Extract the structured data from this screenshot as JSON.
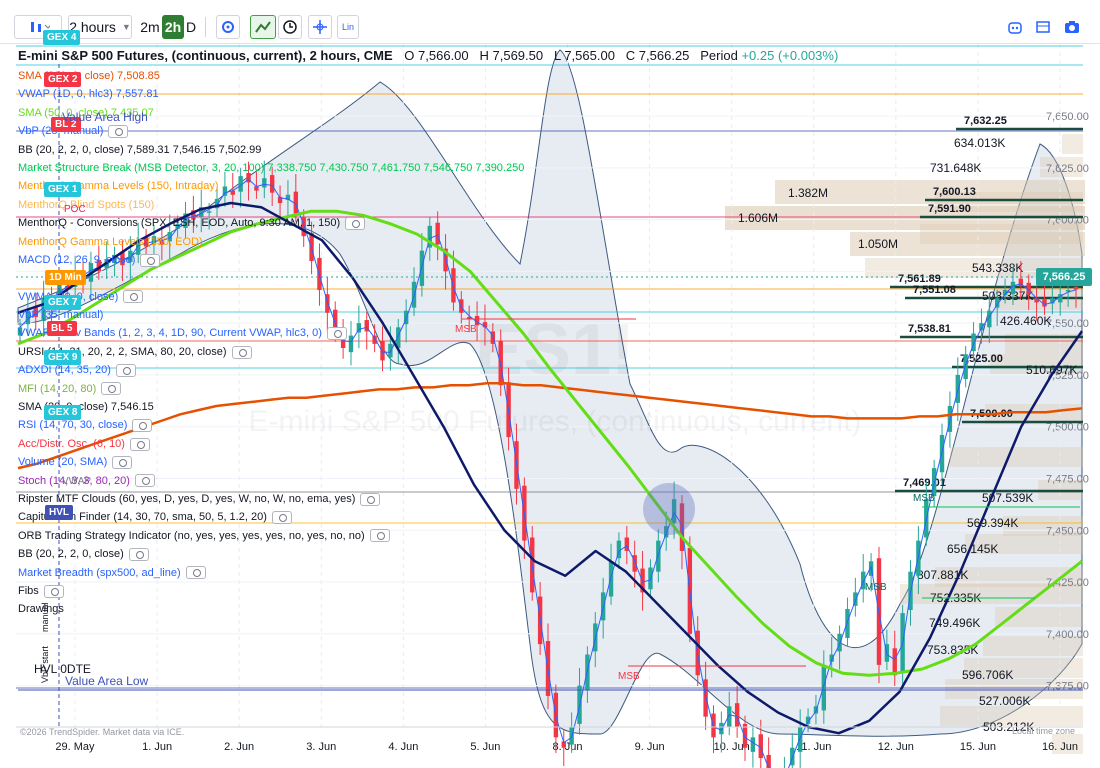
{
  "toolbar": {
    "interval": "2 hours",
    "intervals": [
      "2m",
      "2h",
      "D"
    ],
    "scale_mode": "Lin"
  },
  "title": {
    "symbol": "E-mini S&P 500 Futures, (continuous, current), 2 hours, CME",
    "o_label": "O",
    "o": "7,566.00",
    "h_label": "H",
    "h": "7,569.50",
    "l_label": "L",
    "l": "7,565.00",
    "c_label": "C",
    "c": "7,566.25",
    "period_label": "Period",
    "period_change": "+0.25 (+0.003%)"
  },
  "watermark": {
    "symbol": "ES1!",
    "name": "E-mini S&P 500 Futures, (continuous, current)"
  },
  "indicators": [
    {
      "text": "SMA (200, 0, close)  7,508.85",
      "color": "#e65100",
      "eye": false
    },
    {
      "text": "VWAP (1D, 0, hlc3)  7,557.81",
      "color": "#2962ff",
      "eye": false
    },
    {
      "text": "SMA (50, 0, close)  7,435.07",
      "color": "#64dd17",
      "eye": false
    },
    {
      "text": "VbP (25, manual)",
      "color": "#2962ff",
      "eye": true
    },
    {
      "text": "BB (20, 2, 2, 0, close)  7,589.31  7,546.15  7,502.99",
      "color": "#131722",
      "eye": false
    },
    {
      "text": "Market Structure Break (MSB Detector, 3, 20, 100)  7,338.750  7,430.750  7,461.750  7,546.750  7,390.250",
      "color": "#00c853",
      "eye": false
    },
    {
      "text": "MenthorQ Gamma Levels (150, Intraday)",
      "color": "#ff9800",
      "eye": false
    },
    {
      "text": "MenthorQ Blind Spots (150)",
      "color": "#ffb74d",
      "eye": false
    },
    {
      "text": "MenthorQ - Conversions (SPX, ESH, EOD, Auto, 9:30 AM, 1, 150)",
      "color": "#131722",
      "eye": true
    },
    {
      "text": "MenthorQ Gamma Levels (150, EOD)",
      "color": "#ff9800",
      "eye": false
    },
    {
      "text": "MACD (12, 26, 9, close)",
      "color": "#2962ff",
      "eye": true
    },
    {
      "text": "",
      "color": "#131722",
      "eye": false
    },
    {
      "text": "VWMA (20, 0, close)",
      "color": "#2962ff",
      "eye": true
    },
    {
      "text": "VbP (35, manual)",
      "color": "#2962ff",
      "eye": false
    },
    {
      "text": "VWAP Stdev Bands (1, 2, 3, 4, 1D, 90, Current VWAP, hlc3, 0)",
      "color": "#2962ff",
      "eye": true
    },
    {
      "text": "URSI (14, 21, 20, 2, 2, SMA, 80, 20, close)",
      "color": "#131722",
      "eye": true
    },
    {
      "text": "ADXDI (14, 35, 20)",
      "color": "#2962ff",
      "eye": true
    },
    {
      "text": "MFI (14, 20, 80)",
      "color": "#7cb342",
      "eye": true
    },
    {
      "text": "SMA (20, 0, close)  7,546.15",
      "color": "#131722",
      "eye": false
    },
    {
      "text": "RSI (14, 70, 30, close)",
      "color": "#2962ff",
      "eye": true
    },
    {
      "text": "Acc/Distr. Osc. (6, 10)",
      "color": "#f23645",
      "eye": true
    },
    {
      "text": "Volume (20, SMA)",
      "color": "#2962ff",
      "eye": true
    },
    {
      "text": "Stoch (14, 3, 3, 80, 20)",
      "color": "#9c27b0",
      "eye": true
    },
    {
      "text": "Ripster MTF Clouds (60, yes, D, yes, D, yes, W, no, W, no, ema, yes)",
      "color": "#131722",
      "eye": true
    },
    {
      "text": "Capitulation Finder (14, 30, 70, sma, 50, 5, 1.2, 20)",
      "color": "#131722",
      "eye": true
    },
    {
      "text": "ORB Trading Strategy Indicator (no, yes, yes, yes, yes, no, yes, no, no)",
      "color": "#131722",
      "eye": true
    },
    {
      "text": "BB (20, 2, 2, 0, close)",
      "color": "#131722",
      "eye": true
    },
    {
      "text": "Market Breadth (spx500, ad_line)",
      "color": "#2962ff",
      "eye": true
    },
    {
      "text": "Fibs",
      "color": "#131722",
      "eye": true
    },
    {
      "text": "Drawings",
      "color": "#131722",
      "eye": false
    }
  ],
  "badges": [
    {
      "text": "GEX 4",
      "color": "#26c6da"
    },
    {
      "text": "GEX 2",
      "color": "#f23645"
    },
    {
      "text": "BL 2",
      "color": "#f23645"
    },
    {
      "text": "GEX 1",
      "color": "#26c6da"
    },
    {
      "text": "1D Min",
      "color": "#ff9800"
    },
    {
      "text": "GEX 7",
      "color": "#26c6da"
    },
    {
      "text": "BL 5",
      "color": "#f23645"
    },
    {
      "text": "GEX 9",
      "color": "#26c6da"
    },
    {
      "text": "GEX 8",
      "color": "#26c6da"
    },
    {
      "text": "HVL",
      "color": "#3f51b5"
    }
  ],
  "chart_labels": {
    "value_area_high": "Value Area High",
    "value_area_low": "Value Area Low",
    "poc": "POC",
    "hvl_0dte": "HVL 0DTE",
    "vwap": "VWAP",
    "msb": "MSB",
    "vbp_start": "VbP start",
    "manual": "manual",
    "footer": "©2026 TrendSpider. Market data via ICE.",
    "local_time": "Local time zone"
  },
  "last_price": "7,566.25",
  "levels": [
    "7,632.25",
    "7,600.13",
    "7,591.90",
    "7,561.89",
    "7,551.08",
    "7,538.81",
    "7,525.00",
    "7,500.00",
    "7,469.01"
  ],
  "volume_profile": [
    "634.013K",
    "731.648K",
    "1.382M",
    "1.606M",
    "1.050M",
    "543.338K",
    "503.337K",
    "426.460K",
    "510.697K",
    "507.539K",
    "569.394K",
    "656.145K",
    "807.881K",
    "752.335K",
    "749.496K",
    "753.835K",
    "596.706K",
    "527.006K",
    "503.212K"
  ],
  "colors": {
    "up_candle": "#26a69a",
    "down_candle": "#f23645",
    "sma200": "#e65100",
    "sma50": "#64dd17",
    "sma20_navy": "#0d1a6b",
    "vwap": "#2962ff",
    "bb_fill": "#dfe6ee",
    "vp_bar": "#d9c7ad",
    "level_line": "#1b4d3e"
  },
  "chart_data": {
    "type": "candlestick",
    "title": "E-mini S&P 500 Futures, (continuous, current), 2 hours, CME",
    "x_ticks": [
      "29. May",
      "1. Jun",
      "2. Jun",
      "3. Jun",
      "4. Jun",
      "5. Jun",
      "8. Jun",
      "9. Jun",
      "10. Jun",
      "11. Jun",
      "12. Jun",
      "15. Jun",
      "16. Jun"
    ],
    "y_ticks": [
      7650.0,
      7625.0,
      7600.0,
      7575.0,
      7550.0,
      7525.0,
      7500.0,
      7475.0,
      7450.0,
      7425.0,
      7400.0,
      7375.0
    ],
    "y_range": [
      7355,
      7665
    ],
    "last": {
      "open": 7566.0,
      "high": 7569.5,
      "low": 7565.0,
      "close": 7566.25
    },
    "closes": [
      7548,
      7556,
      7553,
      7562,
      7559,
      7570,
      7566,
      7574,
      7572,
      7579,
      7575,
      7581,
      7583,
      7578,
      7585,
      7590,
      7587,
      7592,
      7588,
      7594,
      7598,
      7603,
      7600,
      7606,
      7604,
      7610,
      7616,
      7612,
      7621,
      7618,
      7614,
      7620,
      7613,
      7608,
      7612,
      7603,
      7592,
      7580,
      7566,
      7555,
      7545,
      7538,
      7544,
      7550,
      7546,
      7540,
      7532,
      7540,
      7548,
      7556,
      7570,
      7585,
      7597,
      7588,
      7575,
      7560,
      7555,
      7552,
      7549,
      7548,
      7540,
      7520,
      7495,
      7470,
      7445,
      7420,
      7395,
      7370,
      7350,
      7345,
      7355,
      7375,
      7390,
      7405,
      7420,
      7435,
      7445,
      7440,
      7430,
      7420,
      7432,
      7445,
      7452,
      7465,
      7440,
      7400,
      7380,
      7360,
      7350,
      7357,
      7365,
      7355,
      7345,
      7350,
      7340,
      7330,
      7325,
      7335,
      7345,
      7355,
      7360,
      7365,
      7385,
      7390,
      7400,
      7412,
      7420,
      7430,
      7435,
      7385,
      7395,
      7380,
      7410,
      7430,
      7445,
      7465,
      7480,
      7496,
      7510,
      7525,
      7535,
      7545,
      7550,
      7556,
      7562,
      7566,
      7570,
      7568,
      7564,
      7560,
      7558,
      7562,
      7564,
      7566,
      7566.25
    ],
    "sma200": [
      7480,
      7482,
      7485,
      7488,
      7491,
      7494,
      7497,
      7500,
      7503,
      7506,
      7508,
      7510,
      7511,
      7512,
      7513,
      7514,
      7514,
      7515,
      7516,
      7517,
      7518,
      7518,
      7519,
      7519,
      7520,
      7520,
      7521,
      7521,
      7520,
      7520,
      7519,
      7518,
      7517,
      7516,
      7515,
      7514,
      7513,
      7512,
      7511,
      7510,
      7509,
      7508,
      7507,
      7506,
      7505,
      7505,
      7504,
      7504,
      7504,
      7504,
      7505,
      7505,
      7506,
      7506,
      7506,
      7507,
      7507,
      7507,
      7508,
      7508.85
    ],
    "sma50": [
      7540,
      7545,
      7552,
      7560,
      7568,
      7576,
      7582,
      7588,
      7594,
      7598,
      7601,
      7604,
      7604,
      7602,
      7598,
      7593,
      7585,
      7575,
      7560,
      7545,
      7528,
      7512,
      7496,
      7480,
      7463,
      7446,
      7432,
      7418,
      7405,
      7394,
      7386,
      7381,
      7380,
      7381,
      7383,
      7388,
      7395,
      7405,
      7415,
      7425,
      7435.07
    ],
    "sma20": [
      7555,
      7560,
      7570,
      7580,
      7590,
      7598,
      7605,
      7608,
      7606,
      7598,
      7590,
      7572,
      7550,
      7525,
      7500,
      7472,
      7450,
      7435,
      7428,
      7440,
      7430,
      7415,
      7400,
      7385,
      7372,
      7362,
      7355,
      7352,
      7358,
      7372,
      7398,
      7430,
      7465,
      7500,
      7525,
      7546.15
    ],
    "volume_profile_levels": [
      7632.25,
      7600.13,
      7591.9,
      7561.89,
      7551.08,
      7538.81,
      7525.0,
      7500.0,
      7469.01
    ]
  }
}
